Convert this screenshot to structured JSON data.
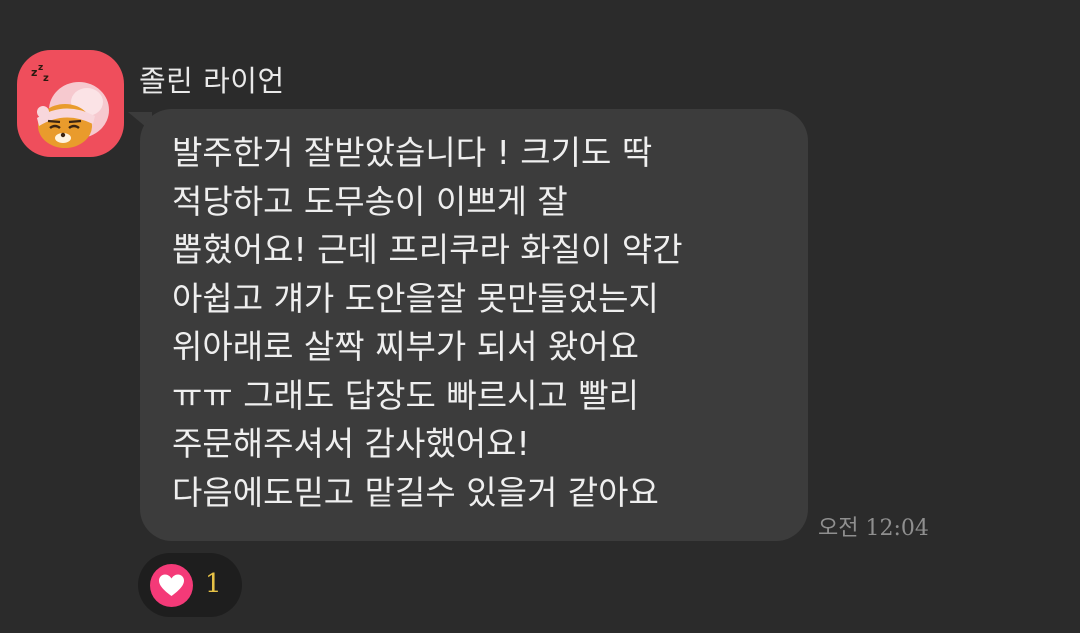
{
  "message": {
    "sender_name": "졸린 라이언",
    "avatar_icon": "sleeping-ryan-icon",
    "avatar_bg": "#ef4e5c",
    "lines": [
      "발주한거 잘받았습니다 ! 크기도 딱",
      "적당하고 도무송이 이쁘게 잘",
      "뽑혔어요! 근데 프리쿠라 화질이 약간",
      "아쉽고 걔가 도안을잘 못만들었는지",
      "위아래로 살짝 찌부가 되서 왔어요",
      "ㅠㅠ 그래도 답장도 빠르시고 빨리",
      "주문해주셔서 감사했어요!",
      "다음에도믿고 맡길수 있을거 같아요"
    ],
    "timestamp": "오전 12:04"
  },
  "reaction": {
    "icon": "heart-icon",
    "count": "1",
    "heart_color": "#f43a78",
    "count_color": "#e6c146"
  }
}
